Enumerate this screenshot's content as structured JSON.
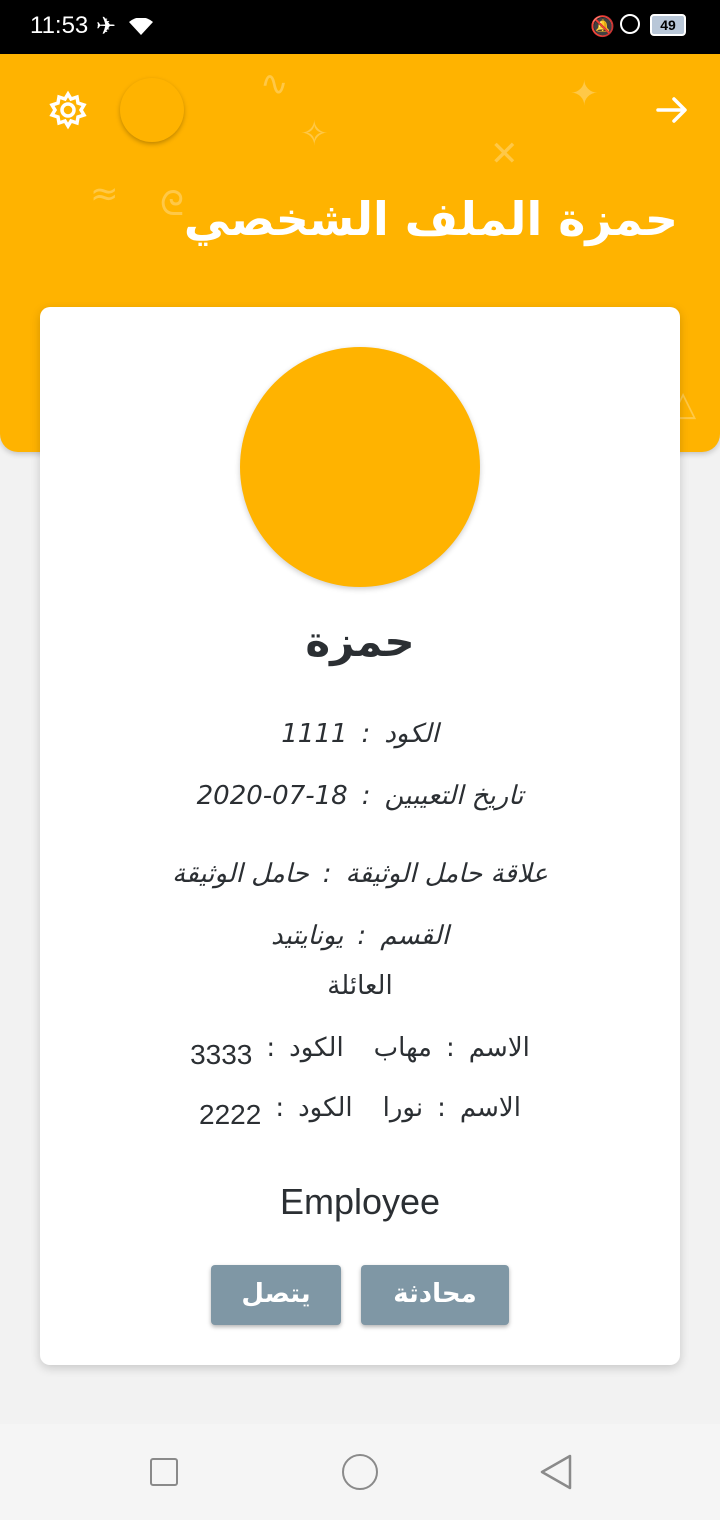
{
  "status_bar": {
    "time": "11:53",
    "battery": "49"
  },
  "header": {
    "title": "حمزة الملف الشخصي"
  },
  "profile": {
    "name": "حمزة",
    "code_label": "الكود",
    "code_value": "1111",
    "hire_date_label": "تاريخ التعيبين",
    "hire_date_value": "2020-07-18",
    "relation_label": "علاقة حامل الوثيقة",
    "relation_value": "حامل الوثيقة",
    "department_label": "القسم",
    "department_value": "يونايتيد",
    "role": "Employee"
  },
  "family": {
    "title": "العائلة",
    "members": [
      {
        "name_label": "الاسم",
        "name": "مهاب",
        "code_label": "الكود",
        "code": "3333"
      },
      {
        "name_label": "الاسم",
        "name": "نورا",
        "code_label": "الكود",
        "code": "2222"
      }
    ]
  },
  "actions": {
    "chat": "محادثة",
    "call": "يتصل"
  },
  "colors": {
    "accent": "#ffb300",
    "button": "#7f97a5"
  },
  "icons": [
    "settings-gear-icon",
    "arrow-forward-icon",
    "airplane-icon",
    "wifi-icon",
    "bell-off-icon",
    "battery-icon"
  ]
}
